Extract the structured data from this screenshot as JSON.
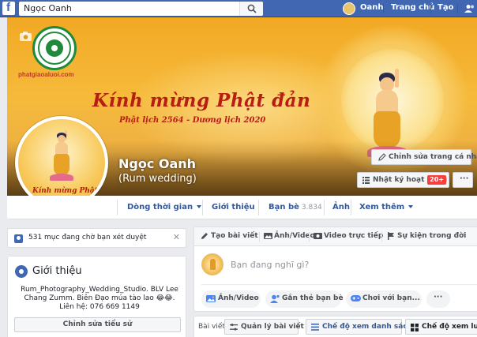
{
  "topnav": {
    "logo": "f",
    "search_value": "Ngọc Oanh",
    "user_name": "Oanh",
    "home": "Trang chủ",
    "create": "Tạo"
  },
  "cover": {
    "site_url": "phatgiaoaluoi.com",
    "greeting": "Kính mừng Phật đản",
    "greeting_sub": "Phật lịch 2564 - Dương lịch 2020"
  },
  "profile": {
    "name": "Ngọc Oanh",
    "alternate_name": "(Rum wedding)",
    "edit_profile": "Chỉnh sửa trang cá nhân",
    "activity_log": "Nhật ký hoạt động",
    "activity_badge": "20+",
    "more": "···"
  },
  "tabs": {
    "timeline": "Dòng thời gian",
    "about": "Giới thiệu",
    "friends": "Bạn bè",
    "friends_count": "3.834",
    "photos": "Ảnh",
    "more": "Xem thêm"
  },
  "pending": {
    "text": "531 mục đang chờ bạn xét duyệt",
    "close": "✕"
  },
  "intro": {
    "title": "Giới thiệu",
    "bio": "Rum_Photography_Wedding_Studio. BLV Lee Chang Zumm. Biên Đạo múa tào lao 😂😂. Liên hệ: 076 669 1149",
    "edit_bio": "Chỉnh sửa tiểu sử"
  },
  "composer": {
    "tab_post": "Tạo bài viết",
    "tab_photo": "Ảnh/Video",
    "tab_live": "Video trực tiếp",
    "tab_event": "Sự kiện trong đời",
    "placeholder": "Bạn đang nghĩ gì?",
    "action_photo": "Ảnh/Video",
    "action_tag": "Gắn thẻ bạn bè",
    "action_play": "Chơi với bạn...",
    "action_more": "···"
  },
  "posts_bar": {
    "label": "Bài viết",
    "manage": "Quản lý bài viết",
    "list_view": "Chế độ xem danh sách",
    "grid_view": "Chế độ xem lưới"
  },
  "colors": {
    "brand": "#4267b2",
    "link": "#365899",
    "badge": "#fa3e3e",
    "cover_gold": "#f6ba3b",
    "greeting_red": "#b81d12"
  }
}
